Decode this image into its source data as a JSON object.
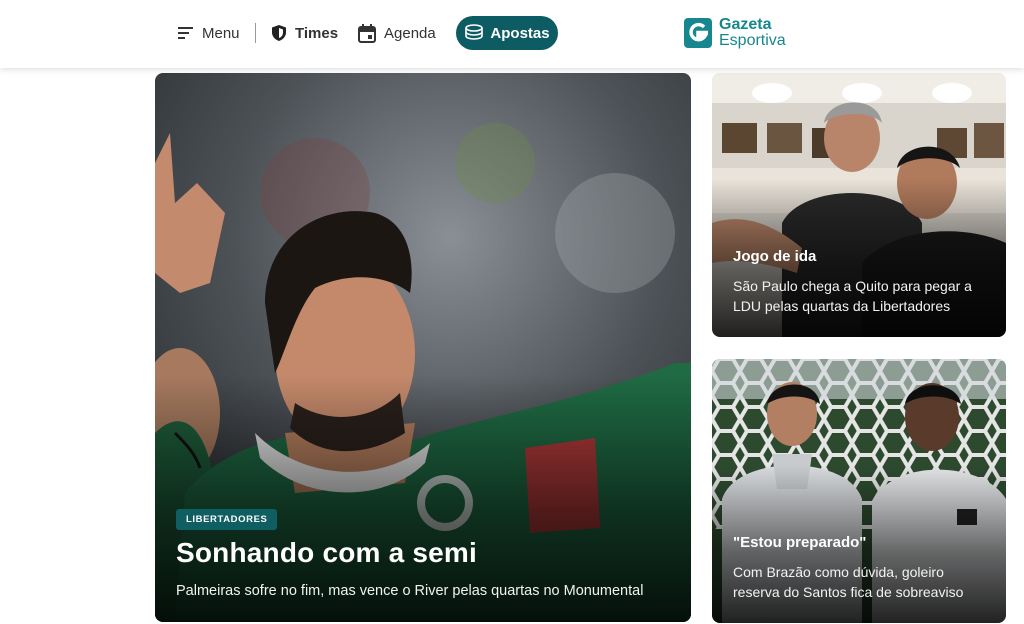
{
  "nav": {
    "menu_label": "Menu",
    "times_label": "Times",
    "agenda_label": "Agenda",
    "apostas_label": "Apostas"
  },
  "logo": {
    "line1": "Gazeta",
    "line2": "Esportiva",
    "color": "#17878f"
  },
  "colors": {
    "accent": "#0d5c63",
    "tag_bg": "#0f5e62"
  },
  "featured": {
    "tag": "LIBERTADORES",
    "title": "Sonhando com a semi",
    "subtitle": "Palmeiras sofre no fim, mas vence o River pelas quartas no Monumental"
  },
  "side_stories": [
    {
      "title": "Jogo de ida",
      "subtitle": "São Paulo chega a Quito para pegar a LDU pelas quartas da Libertadores"
    },
    {
      "title": "\"Estou preparado\"",
      "subtitle": "Com Brazão como dúvida, goleiro reserva do Santos fica de sobreaviso"
    }
  ]
}
